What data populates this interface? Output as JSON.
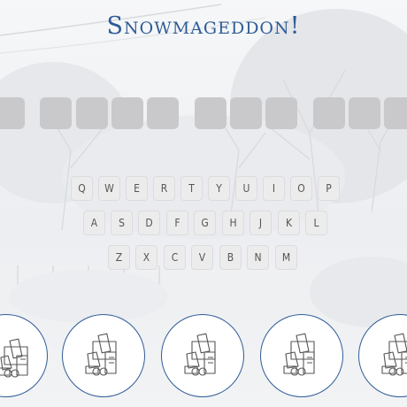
{
  "game": {
    "title": "Snowmageddon!",
    "accent_color": "#2f5c97",
    "slot_color": "#c9c9cb"
  },
  "puzzle": {
    "words": [
      {
        "letters": [
          "",
          "",
          "",
          "",
          ""
        ]
      },
      {
        "letters": [
          "",
          "",
          ""
        ]
      },
      {
        "letters": [
          "",
          "",
          ""
        ]
      }
    ]
  },
  "keyboard": {
    "rows": [
      [
        "Q",
        "W",
        "E",
        "R",
        "T",
        "Y",
        "U",
        "I",
        "O",
        "P"
      ],
      [
        "A",
        "S",
        "D",
        "F",
        "G",
        "H",
        "J",
        "K",
        "L"
      ],
      [
        "Z",
        "X",
        "C",
        "V",
        "B",
        "N",
        "M"
      ]
    ]
  },
  "lives": {
    "count": 5,
    "icon": "snowplow-icon"
  }
}
